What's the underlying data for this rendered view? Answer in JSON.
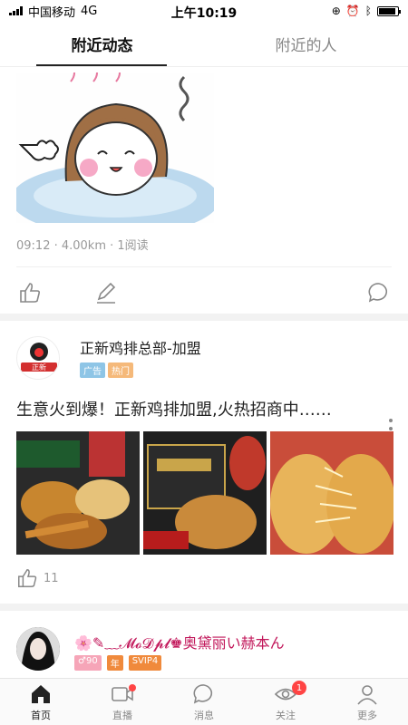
{
  "status": {
    "carrier": "中国移动",
    "network": "4G",
    "time": "上午10:19"
  },
  "tabs": [
    {
      "label": "附近动态",
      "active": true
    },
    {
      "label": "附近的人",
      "active": false
    }
  ],
  "post1": {
    "meta": "09:12 · 4.00km · 1阅读"
  },
  "ad_post": {
    "name": "正新鸡排总部-加盟",
    "tags": [
      {
        "label": "广告",
        "color": "#8ec5e6"
      },
      {
        "label": "热门",
        "color": "#f5b97a"
      }
    ],
    "text": "生意火到爆！正新鸡排加盟,火热招商中……",
    "photos": [
      "fried-chicken-photo",
      "chicken-box-photo",
      "cheese-chicken-photo"
    ],
    "likes": "11"
  },
  "user_post": {
    "name": "🌸✎﹏𝓜𝓸𝓓𝓹𝓵♚奥黛丽い赫本ん",
    "badges": [
      {
        "label": "♂90",
        "color": "#f6a5b8"
      },
      {
        "label": "年",
        "color": "#f08a3c"
      },
      {
        "label": "SVIP4",
        "color": "#f08a3c"
      }
    ]
  },
  "bottom_nav": [
    {
      "label": "首页",
      "icon": "home-icon",
      "active": true
    },
    {
      "label": "直播",
      "icon": "video-icon",
      "active": false,
      "dot": true
    },
    {
      "label": "消息",
      "icon": "message-icon",
      "active": false
    },
    {
      "label": "关注",
      "icon": "eye-icon",
      "active": false,
      "badge": "1"
    },
    {
      "label": "更多",
      "icon": "person-icon",
      "active": false
    }
  ],
  "colors": {
    "accent_red": "#f44336",
    "name_pink": "#c2185b"
  }
}
